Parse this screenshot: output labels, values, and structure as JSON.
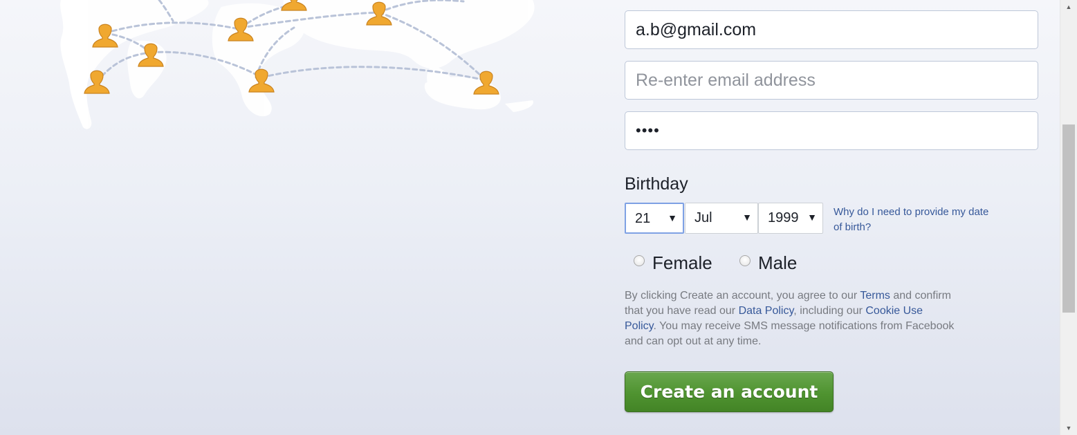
{
  "form": {
    "email_value": "a.b@gmail.com",
    "reenter_email_placeholder": "Re-enter email address",
    "password_value": "••••",
    "birthday_label": "Birthday",
    "day_value": "21",
    "month_value": "Jul",
    "year_value": "1999",
    "dropdown_arrow": "▼",
    "why_link": "Why do I need to provide my date of birth?",
    "gender_female": "Female",
    "gender_male": "Male",
    "terms_1": "By clicking Create an account, you agree to our ",
    "terms_link": "Terms",
    "terms_2": " and confirm that you have read our ",
    "data_policy_link": "Data Policy",
    "terms_3": ", including our ",
    "cookie_link": "Cookie Use Policy",
    "terms_4": ". You may receive SMS message notifications from Facebook and can opt out at any time.",
    "create_button": "Create an account"
  },
  "scrollbar": {
    "up_arrow": "▲",
    "down_arrow": "▼"
  },
  "colors": {
    "button_green": "#4f9330",
    "link_blue": "#365899",
    "person_icon_orange": "#f0a830"
  },
  "icons": [
    "world-map-icon",
    "person-icon"
  ]
}
